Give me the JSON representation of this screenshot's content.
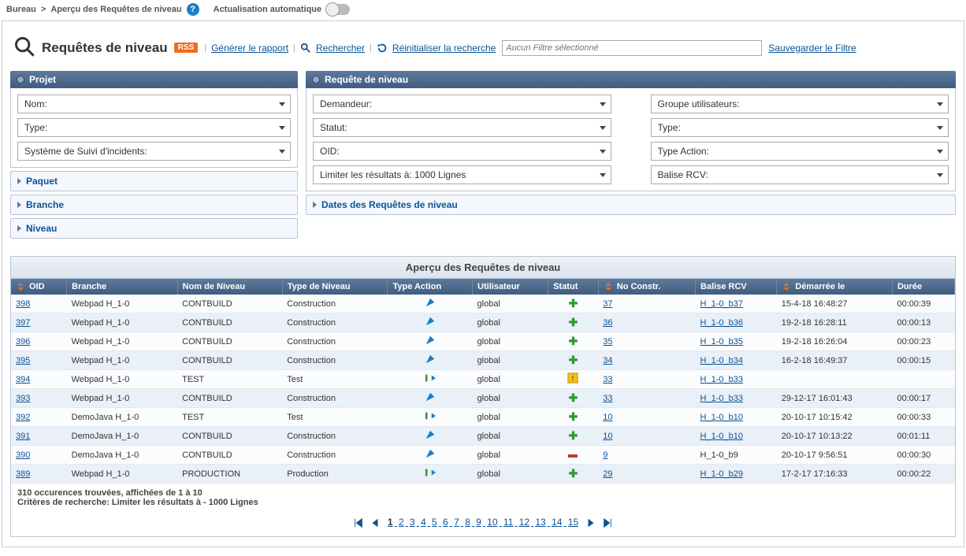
{
  "breadcrumb": {
    "root": "Bureau",
    "sep": ">",
    "page": "Aperçu des Requêtes de niveau"
  },
  "autoRefresh": "Actualisation automatique",
  "title": "Requêtes de niveau",
  "rss": "RSS",
  "links": {
    "generate": "Générer le rapport",
    "search": "Rechercher",
    "reset": "Réinitialiser la recherche"
  },
  "filterPlaceholder": "Aucun Filtre sélectionné",
  "saveFilter": "Sauvegarder le Filtre",
  "panels": {
    "project": "Projet",
    "levelRequest": "Requête de niveau",
    "paquet": "Paquet",
    "branche": "Branche",
    "niveau": "Niveau",
    "dates": "Dates des Requêtes de niveau"
  },
  "projectFields": {
    "name": "Nom:",
    "type": "Type:",
    "its": "Système de Suivi d'incidents:"
  },
  "requestFields": {
    "demandeur": "Demandeur:",
    "statut": "Statut:",
    "oid": "OID:",
    "limit": "Limiter les résultats à: 1000 Lignes",
    "groupe": "Groupe utilisateurs:",
    "type": "Type:",
    "typeAction": "Type Action:",
    "balise": "Balise RCV:"
  },
  "resultsTitle": "Aperçu des Requêtes de niveau",
  "columns": [
    "OID",
    "Branche",
    "Nom de Niveau",
    "Type de Niveau",
    "Type Action",
    "Utilisateur",
    "Statut",
    "No Constr.",
    "Balise RCV",
    "Démarrée le",
    "Durée"
  ],
  "rows": [
    {
      "oid": "398",
      "branche": "Webpad H_1-0",
      "nom": "CONTBUILD",
      "type": "Construction",
      "action": "build",
      "user": "global",
      "statut": "plus",
      "no": "37",
      "balise": "H_1-0_b37",
      "date": "15-4-18 16:48:27",
      "duree": "00:00:39"
    },
    {
      "oid": "397",
      "branche": "Webpad H_1-0",
      "nom": "CONTBUILD",
      "type": "Construction",
      "action": "build",
      "user": "global",
      "statut": "plus",
      "no": "36",
      "balise": "H_1-0_b36",
      "date": "19-2-18 16:28:11",
      "duree": "00:00:13"
    },
    {
      "oid": "396",
      "branche": "Webpad H_1-0",
      "nom": "CONTBUILD",
      "type": "Construction",
      "action": "build",
      "user": "global",
      "statut": "plus",
      "no": "35",
      "balise": "H_1-0_b35",
      "date": "19-2-18 16:26:04",
      "duree": "00:00:23"
    },
    {
      "oid": "395",
      "branche": "Webpad H_1-0",
      "nom": "CONTBUILD",
      "type": "Construction",
      "action": "build",
      "user": "global",
      "statut": "plus",
      "no": "34",
      "balise": "H_1-0_b34",
      "date": "16-2-18 16:49:37",
      "duree": "00:00:15"
    },
    {
      "oid": "394",
      "branche": "Webpad H_1-0",
      "nom": "TEST",
      "type": "Test",
      "action": "deliver",
      "user": "global",
      "statut": "warn",
      "no": "33",
      "balise": "H_1-0_b33",
      "date": "",
      "duree": ""
    },
    {
      "oid": "393",
      "branche": "Webpad H_1-0",
      "nom": "CONTBUILD",
      "type": "Construction",
      "action": "build",
      "user": "global",
      "statut": "plus",
      "no": "33",
      "balise": "H_1-0_b33",
      "date": "29-12-17 16:01:43",
      "duree": "00:00:17"
    },
    {
      "oid": "392",
      "branche": "DemoJava H_1-0",
      "nom": "TEST",
      "type": "Test",
      "action": "deliver",
      "user": "global",
      "statut": "plus",
      "no": "10",
      "balise": "H_1-0_b10",
      "date": "20-10-17 10:15:42",
      "duree": "00:00:33"
    },
    {
      "oid": "391",
      "branche": "DemoJava H_1-0",
      "nom": "CONTBUILD",
      "type": "Construction",
      "action": "build",
      "user": "global",
      "statut": "plus",
      "no": "10",
      "balise": "H_1-0_b10",
      "date": "20-10-17 10:13:22",
      "duree": "00:01:11"
    },
    {
      "oid": "390",
      "branche": "DemoJava H_1-0",
      "nom": "CONTBUILD",
      "type": "Construction",
      "action": "build",
      "user": "global",
      "statut": "minus",
      "no": "9",
      "balise": "H_1-0_b9",
      "baliseLink": false,
      "date": "20-10-17 9:56:51",
      "duree": "00:00:30"
    },
    {
      "oid": "389",
      "branche": "Webpad H_1-0",
      "nom": "PRODUCTION",
      "type": "Production",
      "action": "deliver",
      "user": "global",
      "statut": "plus",
      "no": "29",
      "balise": "H_1-0_b29",
      "date": "17-2-17 17:16:33",
      "duree": "00:00:22"
    }
  ],
  "footer": {
    "count": "310 occurences trouvées, affichées de 1 à 10",
    "criteria": "Critères de recherche: Limiter les résultats à - 1000 Lignes"
  },
  "pages": [
    "1",
    "2",
    "3",
    "4",
    "5",
    "6",
    "7",
    "8",
    "9",
    "10",
    "11",
    "12",
    "13",
    "14",
    "15"
  ]
}
